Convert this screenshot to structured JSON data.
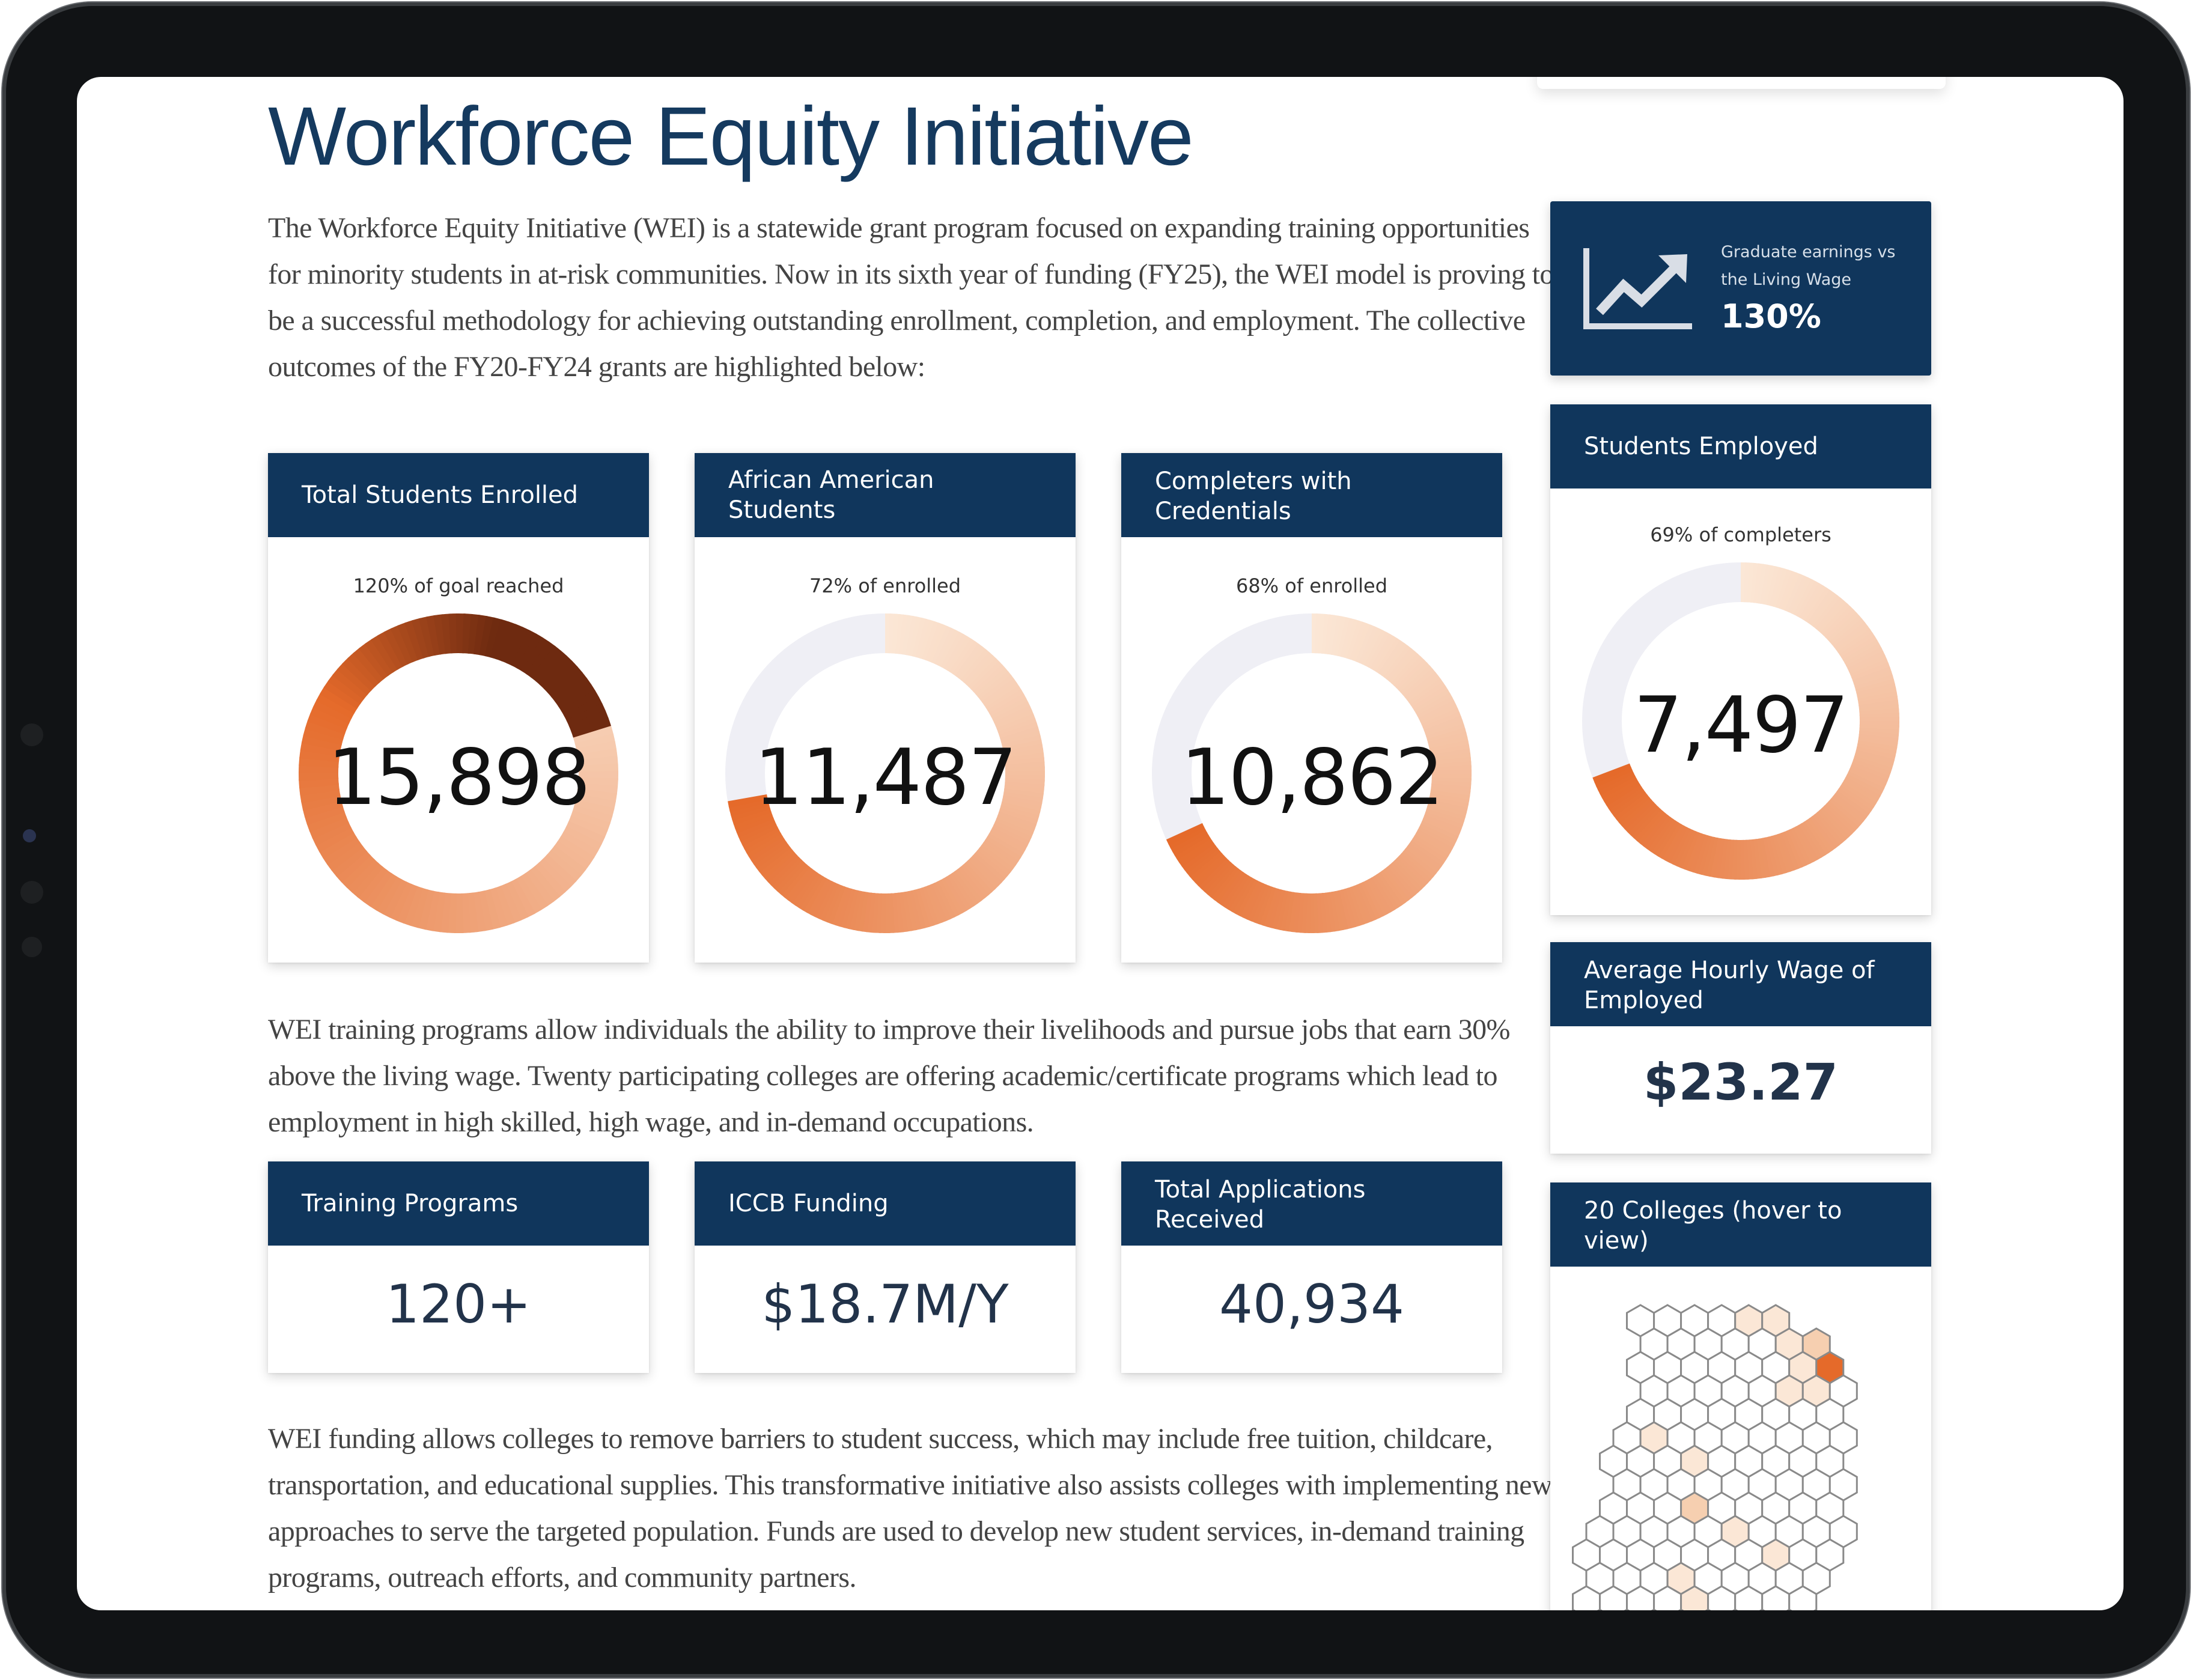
{
  "page": {
    "title": "Workforce Equity Initiative",
    "intro": "The Workforce Equity Initiative (WEI) is a statewide grant program focused on expanding training opportunities for minority students in at-risk communities. Now in its sixth year of funding (FY25), the WEI model is proving to be a successful methodology for achieving outstanding enrollment, completion, and employment. The collective outcomes of the FY20-FY24 grants are highlighted below:",
    "para2": "WEI training programs allow individuals the ability to improve their livelihoods and pursue jobs that earn 30% above the living wage. Twenty participating colleges are offering academic/certificate programs which lead to employment in high skilled, high wage, and in-demand occupations.",
    "para3": "WEI funding allows colleges to remove barriers to student success, which may include free tuition, childcare, transportation, and educational supplies. This transformative initiative also assists colleges with implementing new approaches to serve the targeted population. Funds are used to develop new student services, in-demand training programs, outreach efforts, and community partners."
  },
  "donut_cards": [
    {
      "title": "Total Students Enrolled",
      "subtitle": "120% of goal reached",
      "value": "15,898",
      "percent": 120
    },
    {
      "title": "African American Students",
      "subtitle": "72% of enrolled",
      "value": "11,487",
      "percent": 72
    },
    {
      "title": "Completers with Credentials",
      "subtitle": "68% of enrolled",
      "value": "10,862",
      "percent": 68
    }
  ],
  "value_cards": [
    {
      "title": "Training Programs",
      "value": "120+"
    },
    {
      "title": "ICCB Funding",
      "value": "$18.7M/Y"
    },
    {
      "title": "Total Applications Received",
      "value": "40,934"
    }
  ],
  "sidebar": {
    "living_wage": {
      "desc": "Graduate earnings vs the Living Wage",
      "value": "130%",
      "icon": "trend-up-chart-icon"
    },
    "employed": {
      "title": "Students Employed",
      "subtitle": "69% of completers",
      "value": "7,497",
      "percent": 69
    },
    "avg_wage": {
      "title": "Average Hourly Wage of Employed",
      "value": "$23.27"
    },
    "colleges": {
      "title": "20 Colleges (hover to view)"
    }
  },
  "colors": {
    "header_navy": "#10365c",
    "title_navy": "#153a5f",
    "donut_track": "#efeff5",
    "donut_light": "#fbe7d6",
    "donut_orange": "#e56a2a",
    "donut_dark": "#6e2a10"
  }
}
